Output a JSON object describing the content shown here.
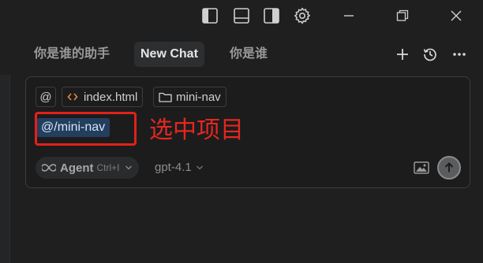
{
  "tabs": [
    {
      "label": "你是谁的助手"
    },
    {
      "label": "New Chat"
    },
    {
      "label": "你是谁"
    }
  ],
  "chat": {
    "context_chips": [
      {
        "label": "index.html",
        "icon": "code-icon"
      },
      {
        "label": "mini-nav",
        "icon": "folder-icon"
      }
    ],
    "mention_text": "@/mini-nav",
    "annotation_text": "选中项目",
    "mode_label": "Agent",
    "mode_shortcut": "Ctrl+I",
    "model_label": "gpt-4.1"
  },
  "colors": {
    "background": "#1f1f20",
    "mention_bg": "#243e5e",
    "annotation_red": "#e5271f",
    "code_icon_orange": "#e08a3c"
  }
}
